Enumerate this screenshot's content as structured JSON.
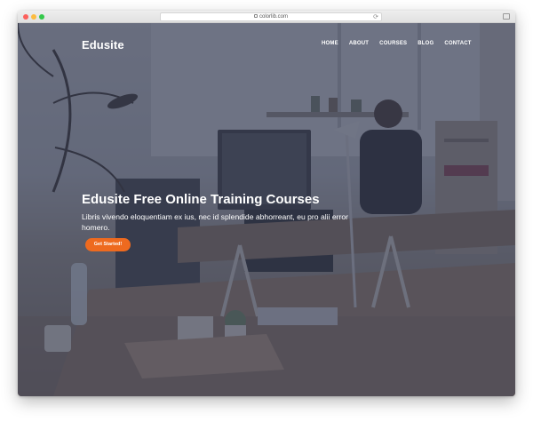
{
  "browser": {
    "url": "colorlib.com",
    "reload_glyph": "⟳"
  },
  "site": {
    "brand": "Edusite",
    "nav": [
      "HOME",
      "ABOUT",
      "COURSES",
      "BLOG",
      "CONTACT"
    ]
  },
  "hero": {
    "headline": "Edusite Free Online Training Courses",
    "subhead": "Libris vivendo eloquentiam ex ius, nec id splendide abhorreant, eu pro alii error homero.",
    "cta_label": "Get Started!"
  },
  "colors": {
    "accent": "#ee6a1f",
    "overlay": "#363c54"
  }
}
